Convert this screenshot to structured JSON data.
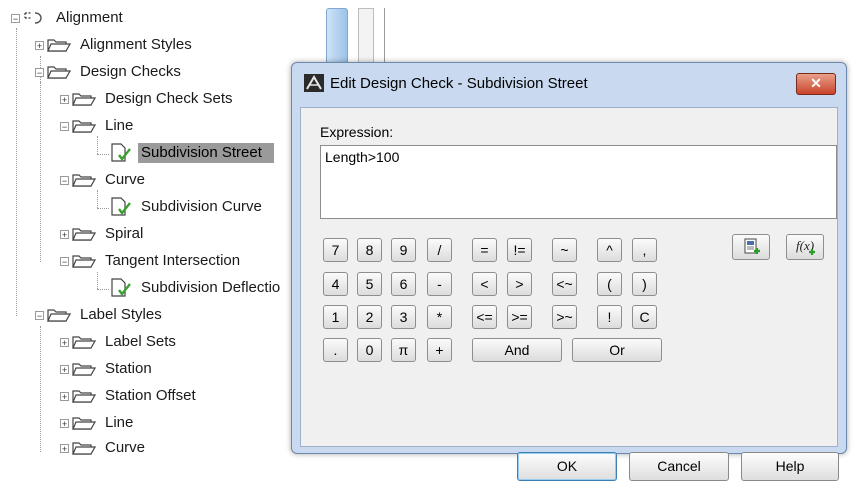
{
  "tree": {
    "items": [
      {
        "id": "alignment",
        "label": "Alignment",
        "icon": "alignment-icon"
      },
      {
        "id": "alignment-styles",
        "label": "Alignment Styles",
        "icon": "folder-icon"
      },
      {
        "id": "design-checks",
        "label": "Design Checks",
        "icon": "folder-icon"
      },
      {
        "id": "design-check-sets",
        "label": "Design Check Sets",
        "icon": "folder-icon"
      },
      {
        "id": "line",
        "label": "Line",
        "icon": "folder-icon"
      },
      {
        "id": "subdivision-street",
        "label": "Subdivision Street",
        "icon": "design-check-icon",
        "selected": true
      },
      {
        "id": "curve",
        "label": "Curve",
        "icon": "folder-icon"
      },
      {
        "id": "subdivision-curve",
        "label": "Subdivision Curve",
        "icon": "design-check-icon"
      },
      {
        "id": "spiral",
        "label": "Spiral",
        "icon": "folder-icon"
      },
      {
        "id": "tangent-intersection",
        "label": "Tangent Intersection",
        "icon": "folder-icon"
      },
      {
        "id": "subdivision-deflection",
        "label": "Subdivision Deflectio",
        "icon": "design-check-icon"
      },
      {
        "id": "label-styles",
        "label": "Label Styles",
        "icon": "folder-icon"
      },
      {
        "id": "label-sets",
        "label": "Label Sets",
        "icon": "folder-icon"
      },
      {
        "id": "station",
        "label": "Station",
        "icon": "folder-icon"
      },
      {
        "id": "station-offset",
        "label": "Station Offset",
        "icon": "folder-icon"
      },
      {
        "id": "line2",
        "label": "Line",
        "icon": "folder-icon"
      },
      {
        "id": "curve2",
        "label": "Curve",
        "icon": "folder-icon"
      }
    ]
  },
  "dialog": {
    "title": "Edit Design Check - Subdivision Street",
    "close_label": "✕",
    "expression_label": "Expression:",
    "expression_value": "Length>100",
    "keypad": {
      "row1": [
        "7",
        "8",
        "9",
        "/",
        "=",
        "!=",
        "~",
        "^",
        ","
      ],
      "row2": [
        "4",
        "5",
        "6",
        "-",
        "<",
        ">",
        "<~",
        "(",
        ")"
      ],
      "row3": [
        "1",
        "2",
        "3",
        "*",
        "<=",
        ">=",
        ">~",
        "!",
        "C"
      ],
      "row4": [
        ".",
        "0",
        "π",
        "+",
        "And",
        "Or"
      ]
    },
    "insert_property_icon": "insert-property-icon",
    "insert_function_icon": "insert-function-icon",
    "buttons": {
      "ok": "OK",
      "cancel": "Cancel",
      "help": "Help"
    }
  },
  "colors": {
    "selection": "#9a9a9a",
    "dialog_frame": "#c9daf0",
    "close_button": "#c9442a",
    "check_green": "#3aa02f"
  }
}
